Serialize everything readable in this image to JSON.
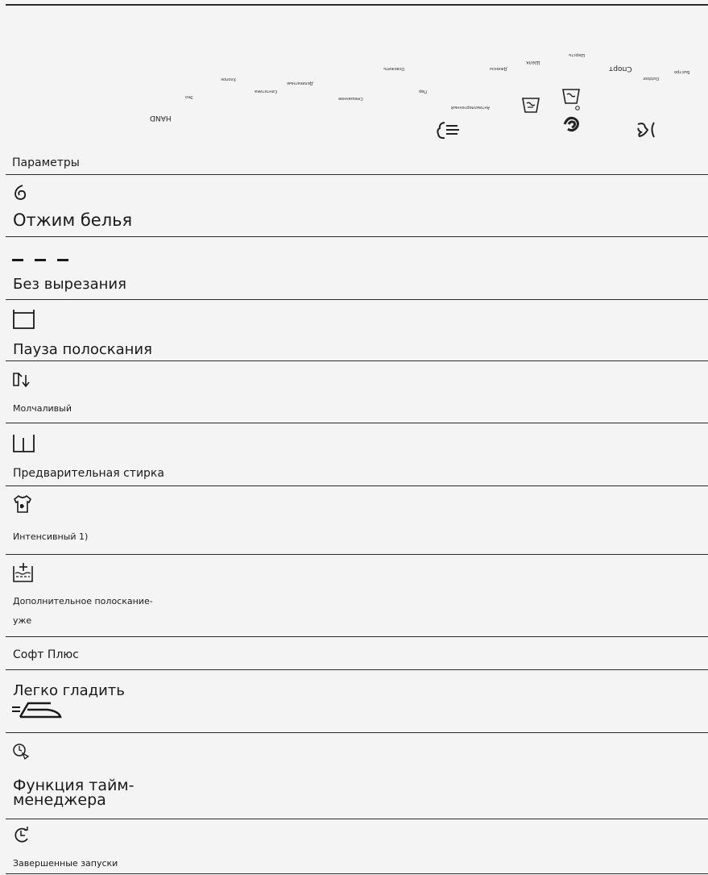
{
  "header": {
    "section_label": "Параметры",
    "program_labels": {
      "hand": "HAND",
      "sport": "Спорт",
      "silk": "Шелк",
      "wool": "Шерсть",
      "synthetic": "Синтетика",
      "cotton": "Хлопок",
      "delicate": "Деликатные",
      "outdoor": "Outdoor",
      "allergy": "Антиаллергенный",
      "steam": "Пар",
      "denim": "Джинсы",
      "eco": "Эко",
      "refresh": "Освежить",
      "quick": "Быстро",
      "mix": "Смешанное"
    }
  },
  "rows": [
    {
      "label": "Отжим белья",
      "icon": "spin-icon"
    },
    {
      "label": "Без вырезания",
      "icon": "no-spin-dashes-icon"
    },
    {
      "label": "Пауза полоскания",
      "icon": "rinse-hold-icon"
    },
    {
      "label": "Молчаливый",
      "icon": "silent-icon"
    },
    {
      "label": "Предварительная стирка",
      "icon": "prewash-icon"
    },
    {
      "label": "Интенсивный 1)",
      "icon": "intensive-stain-icon"
    },
    {
      "label_line1": "Дополнительное полоскание-",
      "label_line2": "уже",
      "icon": "extra-rinse-icon"
    },
    {
      "label": "Софт Плюс"
    },
    {
      "label": "Легко гладить",
      "icon": "easy-iron-icon"
    },
    {
      "label_line1": "Функция тайм-",
      "label_line2": "менеджера",
      "icon": "time-manager-icon"
    },
    {
      "label": "Завершенные запуски",
      "icon": "delay-start-icon"
    }
  ]
}
